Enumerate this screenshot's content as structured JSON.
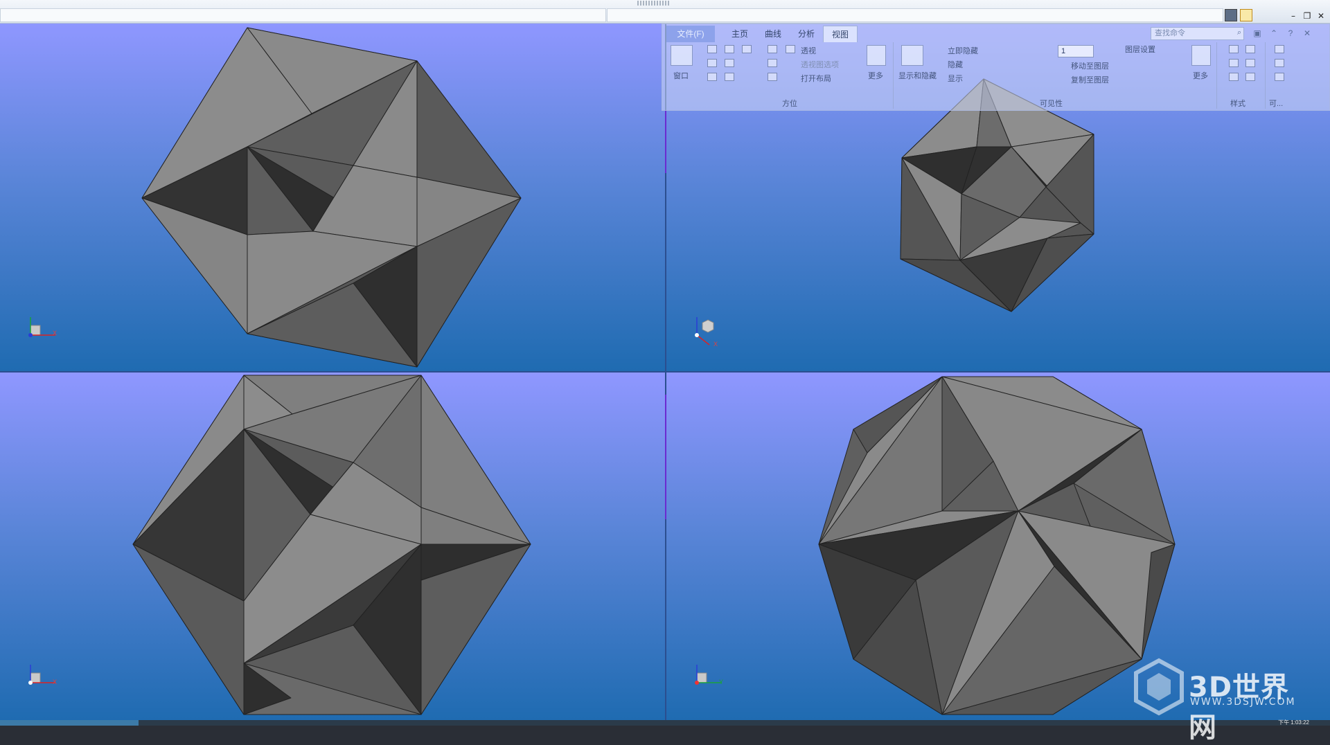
{
  "ribbon": {
    "tabs": [
      {
        "label": "文件(F)"
      },
      {
        "label": "主页"
      },
      {
        "label": "曲线"
      },
      {
        "label": "分析"
      },
      {
        "label": "视图"
      }
    ],
    "active_tab": "视图",
    "search_placeholder": "查找命令",
    "groups": {
      "orientation": {
        "label": "方位",
        "window_label": "窗口",
        "perspective": "透视",
        "perspective_options": "透视图选项",
        "open_layout": "打开布局",
        "more": "更多"
      },
      "visibility": {
        "label": "可见性",
        "show_hide": "显示和隐藏",
        "immediate_hide": "立即隐藏",
        "hide": "隐藏",
        "show": "显示",
        "layer_value": "1",
        "move_to_layer": "移动至图层",
        "copy_to_layer": "复制至图层",
        "layer_settings": "图层设置",
        "more": "更多"
      },
      "style": {
        "label": "样式"
      },
      "visualization": {
        "label": "可..."
      }
    }
  },
  "window_buttons": [
    "–",
    "❐",
    "✕"
  ],
  "viewports": [
    {
      "id": "top-left",
      "axis_labels": [
        "X",
        "Y"
      ]
    },
    {
      "id": "top-right",
      "axis_labels": [
        "X",
        "Y"
      ]
    },
    {
      "id": "bottom-left",
      "axis_labels": [
        "X",
        "Z"
      ]
    },
    {
      "id": "bottom-right",
      "axis_labels": [
        "Y",
        "Z"
      ]
    }
  ],
  "watermark": {
    "title": "3D世界网",
    "url": "WWW.3DSJW.COM"
  },
  "status_text": "下午 1:03:22",
  "colors": {
    "viewport_top": "#8f97ff",
    "viewport_bottom": "#1f6bb1",
    "face_light": "#8a8a8a",
    "face_mid": "#5a5a5a",
    "face_dark": "#2f2f2f"
  }
}
